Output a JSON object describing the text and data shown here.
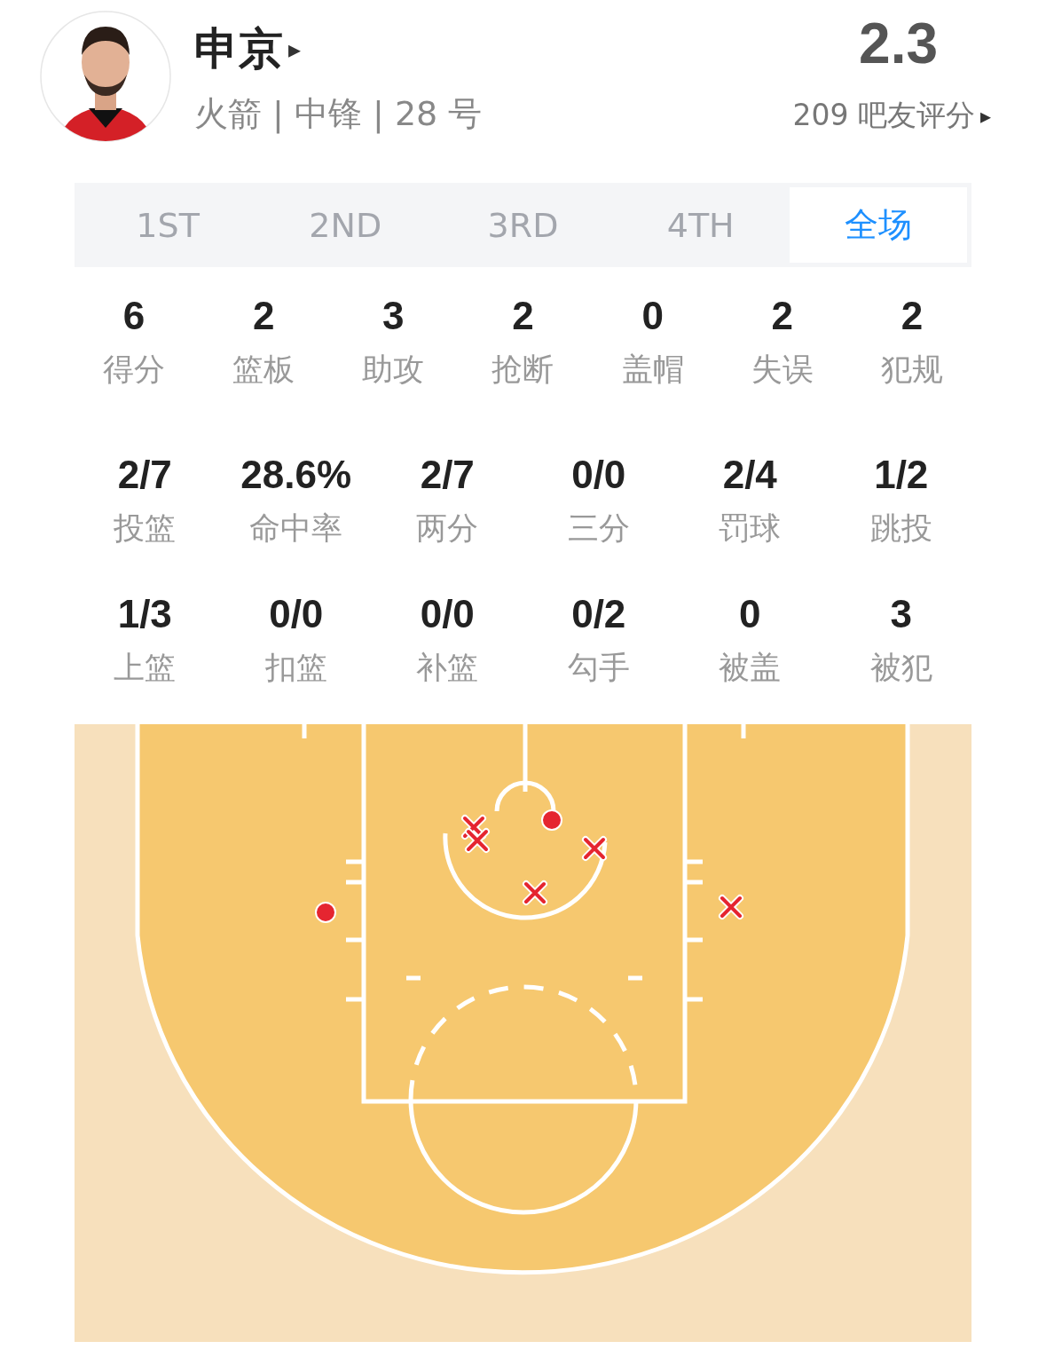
{
  "player": {
    "name": "申京",
    "arrow": "▸",
    "info": "火箭 | 中锋 | 28 号"
  },
  "rating": {
    "score": "2.3",
    "votes": "209 吧友评分",
    "arrow": "▸"
  },
  "tabs": [
    {
      "label": "1ST",
      "selected": false
    },
    {
      "label": "2ND",
      "selected": false
    },
    {
      "label": "3RD",
      "selected": false
    },
    {
      "label": "4TH",
      "selected": false
    },
    {
      "label": "全场",
      "selected": true
    }
  ],
  "main_stats": [
    {
      "value": "6",
      "label": "得分"
    },
    {
      "value": "2",
      "label": "篮板"
    },
    {
      "value": "3",
      "label": "助攻"
    },
    {
      "value": "2",
      "label": "抢断"
    },
    {
      "value": "0",
      "label": "盖帽"
    },
    {
      "value": "2",
      "label": "失误"
    },
    {
      "value": "2",
      "label": "犯规"
    }
  ],
  "shooting_stats": [
    {
      "value": "2/7",
      "label": "投篮"
    },
    {
      "value": "28.6%",
      "label": "命中率"
    },
    {
      "value": "2/7",
      "label": "两分"
    },
    {
      "value": "0/0",
      "label": "三分"
    },
    {
      "value": "2/4",
      "label": "罚球"
    },
    {
      "value": "1/2",
      "label": "跳投"
    }
  ],
  "shot_type_stats": [
    {
      "value": "1/3",
      "label": "上篮"
    },
    {
      "value": "0/0",
      "label": "扣篮"
    },
    {
      "value": "0/0",
      "label": "补篮"
    },
    {
      "value": "0/2",
      "label": "勾手"
    },
    {
      "value": "0",
      "label": "被盖"
    },
    {
      "value": "3",
      "label": "被犯"
    }
  ],
  "shot_chart": {
    "shots": [
      {
        "made": true
      },
      {
        "made": true
      },
      {
        "made": false
      },
      {
        "made": false
      },
      {
        "made": false
      },
      {
        "made": false
      },
      {
        "made": false
      }
    ]
  }
}
